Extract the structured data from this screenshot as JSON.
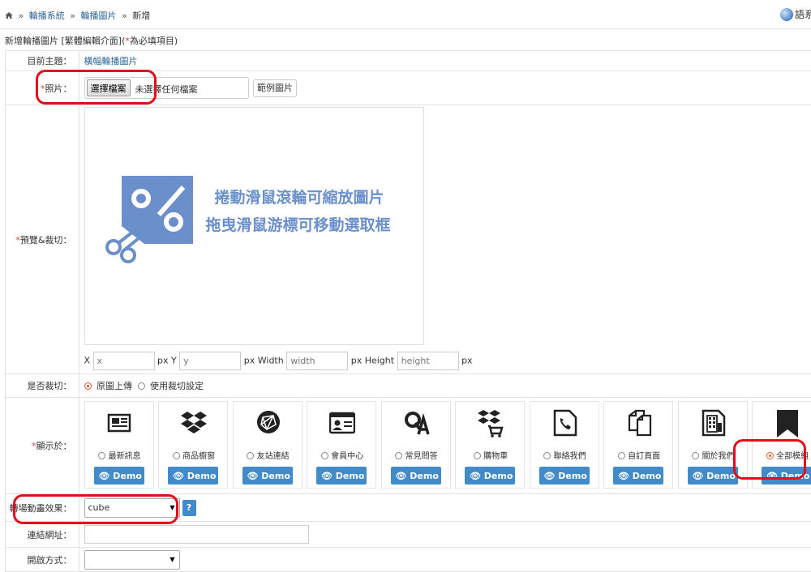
{
  "breadcrumb": {
    "items": [
      "輪播系統",
      "輪播圖片",
      "新增"
    ],
    "sep": "»"
  },
  "language_label": "語系",
  "form": {
    "title": "新增輪播圖片 [繁體編輯介面](",
    "required_star": "*",
    "required_note": "為必填項目)",
    "topic": {
      "label": "目前主題：",
      "value": "橫幅輪播圖片"
    },
    "photo": {
      "label": "照片：",
      "choose_btn": "選擇檔案",
      "no_file": "未選擇任何檔案",
      "example_btn": "範例圖片"
    },
    "crop": {
      "label": "預覽&裁切：",
      "line1": "捲動滑鼠滾輪可縮放圖片",
      "line2": "拖曳滑鼠游標可移動選取框",
      "x_label": "X",
      "x_ph": "x",
      "y_label": "px Y",
      "y_ph": "y",
      "w_label": "px Width",
      "w_ph": "width",
      "h_label": "px Height",
      "h_ph": "height",
      "end_label": "px"
    },
    "crop_option": {
      "label": "是否裁切：",
      "opt1": "原圖上傳",
      "opt2": "使用裁切設定",
      "selected": "opt1"
    },
    "display": {
      "label": "顯示於：",
      "demo_label": "Demo",
      "modules": [
        {
          "label": "最新訊息",
          "icon": "news-icon",
          "selected": false
        },
        {
          "label": "商品櫥窗",
          "icon": "dropbox-icon",
          "selected": false
        },
        {
          "label": "友站連結",
          "icon": "network-icon",
          "selected": false
        },
        {
          "label": "會員中心",
          "icon": "member-card-icon",
          "selected": false
        },
        {
          "label": "常見問答",
          "icon": "qa-icon",
          "selected": false
        },
        {
          "label": "購物車",
          "icon": "cart-box-icon",
          "selected": false
        },
        {
          "label": "聯絡我們",
          "icon": "phone-icon",
          "selected": false
        },
        {
          "label": "自訂頁面",
          "icon": "pages-icon",
          "selected": false
        },
        {
          "label": "關於我們",
          "icon": "building-icon",
          "selected": false
        },
        {
          "label": "全部模組",
          "icon": "bookmark-icon",
          "selected": true
        }
      ]
    },
    "transition": {
      "label": "轉場動畫效果：",
      "value": "cube",
      "help": "?"
    },
    "url": {
      "label": "連結網址："
    },
    "open_mode": {
      "label": "開啟方式："
    }
  }
}
